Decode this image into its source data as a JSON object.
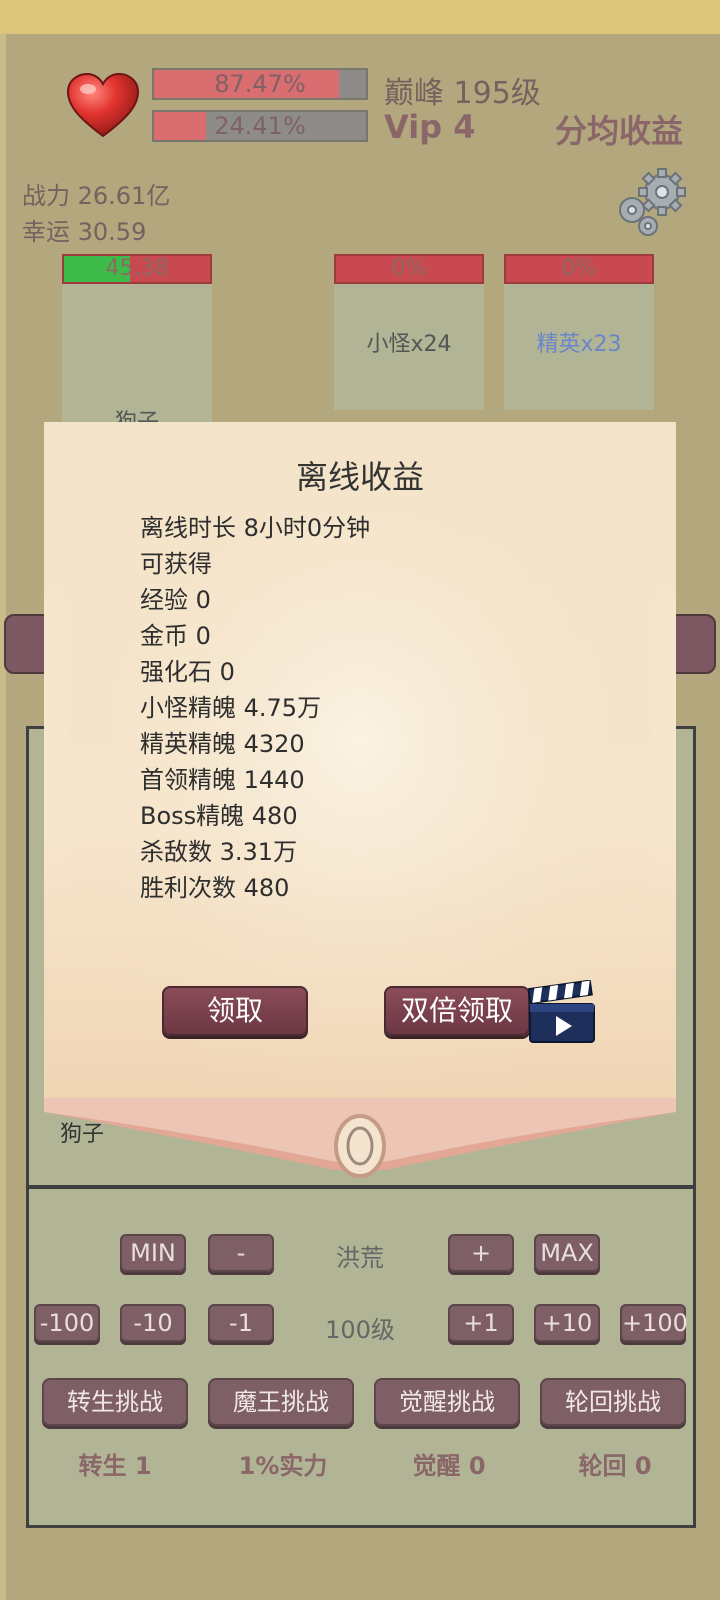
{
  "header": {
    "exp_bar": {
      "value": 0.8747,
      "text": "87.47%"
    },
    "vip_bar": {
      "value": 0.2441,
      "text": "24.41%"
    },
    "level": "巅峰 195级",
    "vip": "Vip 4",
    "avg_income": "分均收益",
    "power": "战力 26.61亿",
    "luck": "幸运 30.59",
    "heart_icon": "heart-icon",
    "gear_icon": "gear-icon"
  },
  "cards": [
    {
      "bar_text": "45.38",
      "green_fraction": 0.45,
      "label": "狗子"
    },
    {
      "bar_text": "0%",
      "green_fraction": 0,
      "label": "小怪x24",
      "label_color": "#555555"
    },
    {
      "bar_text": "0%",
      "green_fraction": 0,
      "label": "精英x23",
      "label_color": "#6a85c8"
    }
  ],
  "dialog": {
    "title": "离线收益",
    "lines": [
      "离线时长 8小时0分钟",
      "可获得",
      "经验   0",
      "金币   0",
      "强化石  0",
      "小怪精魄 4.75万",
      "精英精魄 4320",
      "首领精魄 1440",
      "Boss精魄 480",
      "杀敌数  3.31万",
      "胜利次数 480"
    ],
    "claim_button": "领取",
    "double_claim_button": "双倍领取",
    "video_icon": "clapperboard-icon"
  },
  "behind_text": "狗子",
  "controls": {
    "row1": {
      "min": "MIN",
      "minus": "-",
      "label": "洪荒",
      "plus": "+",
      "max": "MAX"
    },
    "row2": {
      "m100": "-100",
      "m10": "-10",
      "m1": "-1",
      "label": "100级",
      "p1": "+1",
      "p10": "+10",
      "p100": "+100"
    },
    "challenges": [
      "转生挑战",
      "魔王挑战",
      "觉醒挑战",
      "轮回挑战"
    ],
    "stats": [
      "转生 1",
      "1%实力",
      "觉醒 0",
      "轮回 0"
    ]
  },
  "colors": {
    "background": "#b3a77e",
    "top_bar": "#dcc57a",
    "panel": "#b1b595",
    "button": "#7f5f66",
    "dialog_button": "#7a4250",
    "accent_text": "#8a6669"
  }
}
